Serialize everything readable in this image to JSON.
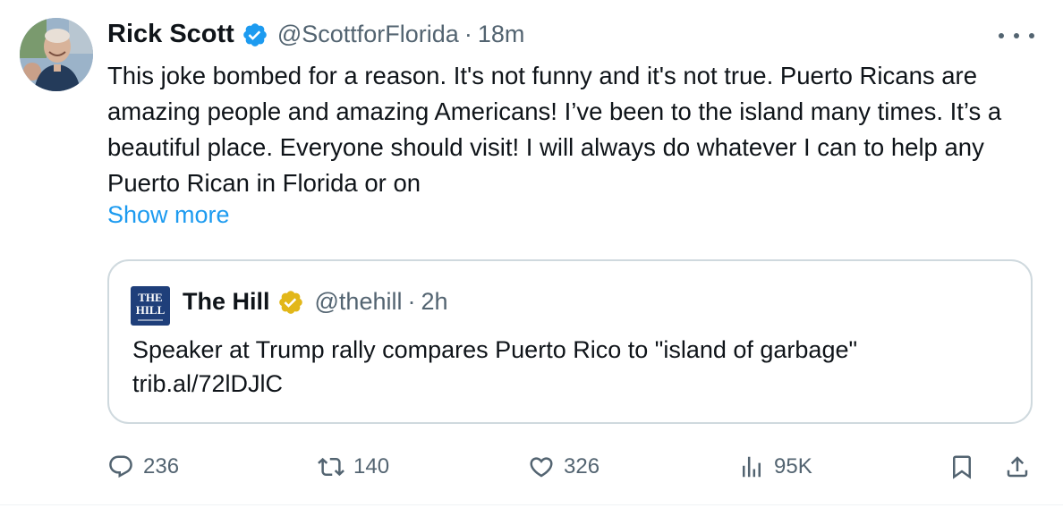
{
  "author": {
    "name": "Rick Scott",
    "handle": "@ScottforFlorida",
    "separator": "·",
    "time": "18m",
    "verified_color": "#1d9bf0"
  },
  "tweet": {
    "text": "This joke bombed for a reason. It's not funny and it's not true. Puerto Ricans are amazing people and amazing Americans! I’ve been to the island many times. It’s a beautiful place. Everyone should visit! I will always do whatever I can to help any Puerto Rican in Florida or on",
    "show_more": "Show more"
  },
  "quoted": {
    "logo_text_top": "THE",
    "logo_text_bottom": "HILL",
    "name": "The Hill",
    "handle": "@thehill",
    "separator": "·",
    "time": "2h",
    "badge_color": "#e2b719",
    "text_line1": "Speaker at Trump rally compares Puerto Rico to \"island of garbage\"",
    "text_line2": "trib.al/72lDJlC"
  },
  "actions": {
    "replies": "236",
    "reposts": "140",
    "likes": "326",
    "views": "95K"
  },
  "icons": {
    "reply": "reply-icon",
    "repost": "repost-icon",
    "like": "heart-icon",
    "views": "views-icon",
    "bookmark": "bookmark-icon",
    "share": "share-icon",
    "more": "more-icon"
  },
  "colors": {
    "text": "#0f1419",
    "secondary": "#536471",
    "link": "#1d9bf0",
    "border": "#cfd9de"
  }
}
